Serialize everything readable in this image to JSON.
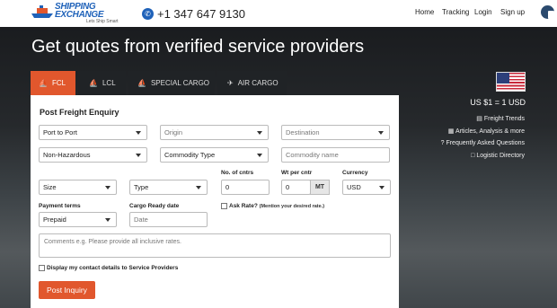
{
  "header": {
    "logo_line1": "SHIPPING",
    "logo_line2": "EXCHANGE",
    "logo_tagline": "Lets Ship Smart",
    "phone": "+1 347 647 9130",
    "nav": [
      "Home",
      "Tracking",
      "Login",
      "Sign up"
    ]
  },
  "hero": {
    "title": "Get quotes from verified service providers"
  },
  "tabs": [
    {
      "label": "FCL",
      "icon": "ship-icon",
      "active": true
    },
    {
      "label": "LCL",
      "icon": "ship-icon",
      "active": false
    },
    {
      "label": "SPECIAL CARGO",
      "icon": "ship-icon",
      "active": false
    },
    {
      "label": "AIR CARGO",
      "icon": "plane-icon",
      "active": false
    }
  ],
  "sidebar": {
    "flag": "us-flag-icon",
    "rate": "US $1 = 1 USD",
    "links": [
      "Freight Trends",
      "Articles, Analysis & more",
      "Frequently Asked Questions",
      "Logistic Directory"
    ]
  },
  "form": {
    "title": "Post Freight Enquiry",
    "route_type": "Port to Port",
    "origin_placeholder": "Origin",
    "destination_placeholder": "Destination",
    "hazard": "Non-Hazardous",
    "commodity_type": "Commodity Type",
    "commodity_name_placeholder": "Commodity name",
    "size": "Size",
    "type": "Type",
    "cntrs_label": "No. of cntrs",
    "cntrs_value": "0",
    "wt_label": "Wt per cntr",
    "wt_value": "0",
    "wt_unit": "MT",
    "currency_label": "Currency",
    "currency_value": "USD",
    "payment_label": "Payment terms",
    "payment_value": "Prepaid",
    "ready_label": "Cargo Ready date",
    "ready_placeholder": "Date",
    "ask_rate_label": "Ask Rate?",
    "ask_rate_note": "(Mention your desired rate.)",
    "comments_placeholder": "Comments e.g.  Please provide all inclusive rates.",
    "display_contact_label": "Display my contact details to Service Providers",
    "submit_label": "Post Inquiry"
  },
  "colors": {
    "accent": "#e1572d",
    "brand": "#1f62b9"
  }
}
